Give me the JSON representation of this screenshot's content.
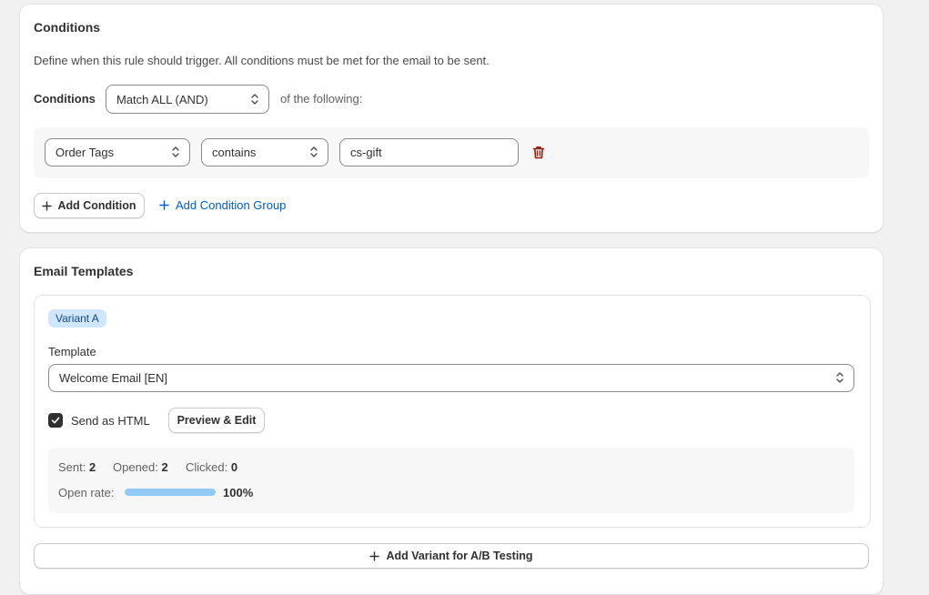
{
  "conditions_card": {
    "title": "Conditions",
    "description": "Define when this rule should trigger. All conditions must be met for the email to be sent.",
    "match_label": "Conditions",
    "match_select": "Match ALL (AND)",
    "match_suffix": "of the following:",
    "rows": [
      {
        "field": "Order Tags",
        "operator": "contains",
        "value": "cs-gift"
      }
    ],
    "add_condition": "Add Condition",
    "add_condition_group": "Add Condition Group"
  },
  "templates_card": {
    "title": "Email Templates",
    "variant": {
      "badge": "Variant A",
      "template_label": "Template",
      "template_value": "Welcome Email [EN]",
      "send_html_label": "Send as HTML",
      "send_html_checked": true,
      "preview_button": "Preview & Edit",
      "stats": {
        "sent_label": "Sent:",
        "sent_value": "2",
        "opened_label": "Opened:",
        "opened_value": "2",
        "clicked_label": "Clicked:",
        "clicked_value": "0",
        "open_rate_label": "Open rate:",
        "open_rate_value": "100%",
        "open_rate_fraction": 1.0
      }
    },
    "add_variant": "Add Variant for A/B Testing"
  },
  "colors": {
    "link": "#005bd3",
    "delete_icon": "#8e1f0b",
    "badge_bg": "#cfe6fc",
    "progress_fill": "#92c9f7"
  },
  "icons": {
    "select_chevron": "chevron-up-down-icon",
    "delete": "trash-icon",
    "add": "plus-icon",
    "checkbox": "checkmark-icon"
  }
}
